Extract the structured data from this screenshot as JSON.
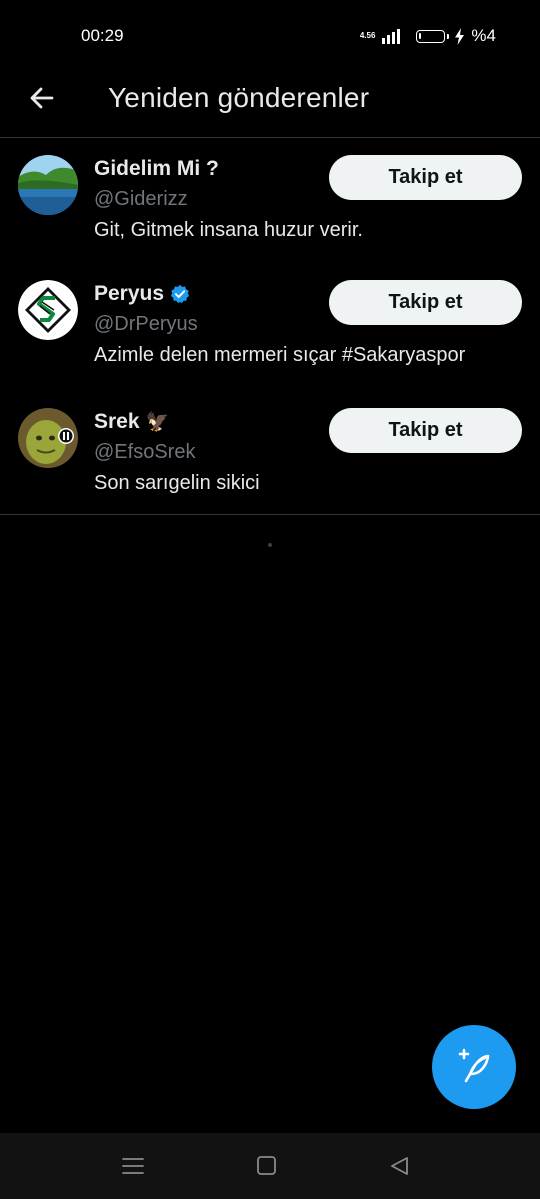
{
  "status_bar": {
    "time": "00:29",
    "net_speed": "4.56",
    "battery_text": "%4"
  },
  "header": {
    "title": "Yeniden gönderenler",
    "back_icon": "arrow-left-icon"
  },
  "users": [
    {
      "display_name": "Gidelim Mi ?",
      "handle": "@Giderizz",
      "bio": "Git, Gitmek insana huzur verir.",
      "verified": false,
      "emoji": "",
      "follow_label": "Takip et"
    },
    {
      "display_name": "Peryus",
      "handle": "@DrPeryus",
      "bio": "Azimle delen mermeri sıçar #Sakaryaspor",
      "verified": true,
      "emoji": "",
      "follow_label": "Takip et"
    },
    {
      "display_name": "Srek",
      "handle": "@EfsoSrek",
      "bio": "Son sarıgelin sikici",
      "verified": false,
      "emoji": "🦅",
      "follow_label": "Takip et"
    }
  ],
  "fab": {
    "icon": "compose-feather-icon"
  },
  "colors": {
    "background": "#000000",
    "accent": "#1d9bf0",
    "divider": "#2f3336",
    "secondary_text": "#71767b",
    "button_bg": "#eff3f4"
  },
  "nav_bar": {
    "icons": [
      "recents-icon",
      "home-icon",
      "back-icon"
    ]
  }
}
